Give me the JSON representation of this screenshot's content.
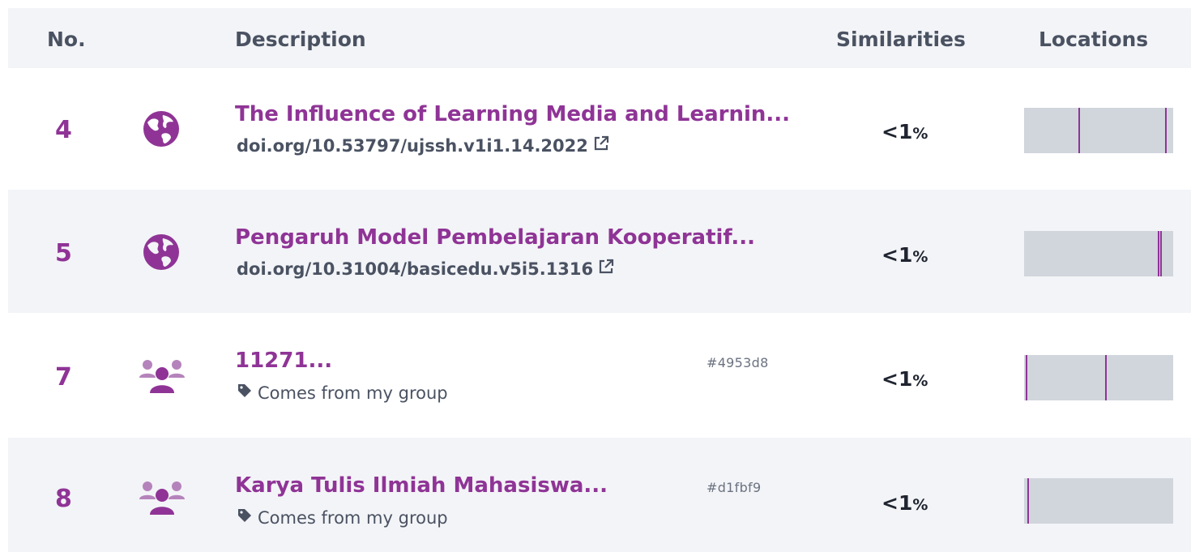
{
  "header": {
    "no": "No.",
    "description": "Description",
    "similarities": "Similarities",
    "locations": "Locations"
  },
  "rows": [
    {
      "number": "4",
      "icon": "globe-icon",
      "title": "The Influence of Learning Media and Learnin...",
      "source": "doi.org/10.53797/ujssh.v1i1.14.2022",
      "similarity_symbol": "<1",
      "similarity_unit": "%",
      "locations": [
        0.37,
        0.955
      ]
    },
    {
      "number": "5",
      "icon": "globe-icon",
      "title": "Pengaruh Model Pembelajaran Kooperatif...",
      "source": "doi.org/10.31004/basicedu.v5i5.1316",
      "similarity_symbol": "<1",
      "similarity_unit": "%",
      "locations": [
        0.905,
        0.925
      ]
    },
    {
      "number": "7",
      "icon": "group-icon",
      "title": "11271...",
      "source": "Comes from my group",
      "hash": "#4953d8",
      "similarity_symbol": "<1",
      "similarity_unit": "%",
      "locations": [
        0.01,
        0.55
      ]
    },
    {
      "number": "8",
      "icon": "group-icon",
      "title": "Karya Tulis Ilmiah Mahasiswa...",
      "source": "Comes from my group",
      "hash": "#d1fbf9",
      "similarity_symbol": "<1",
      "similarity_unit": "%",
      "locations": [
        0.02
      ]
    }
  ],
  "colors": {
    "accent": "#8f3496",
    "row_alt": "#f3f4f7",
    "bar_bg": "#d1d5dc"
  }
}
